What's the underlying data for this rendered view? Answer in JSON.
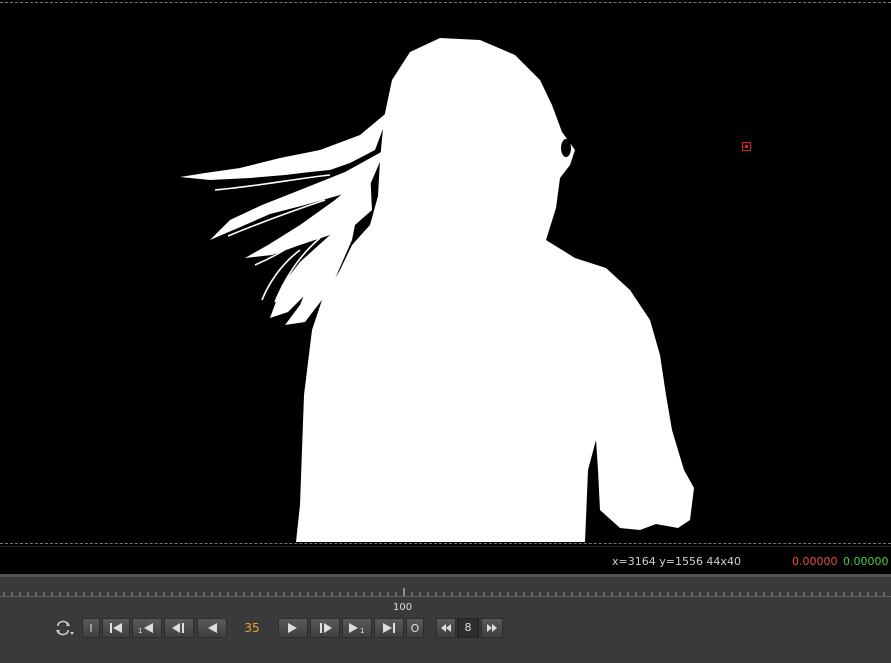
{
  "viewer": {
    "image": "white alpha matte of woman with long flowing hair on black background"
  },
  "info_bar": {
    "coords": "x=3164 y=1556 44x40",
    "red_value": "0.00000",
    "green_value": "0.00000"
  },
  "timeline": {
    "frame_label": "100",
    "current_frame": "35",
    "increment": "8",
    "in_label": "I",
    "out_label": "O"
  },
  "colors": {
    "accent_frame": "#f0a030",
    "red": "#e84a4a",
    "green": "#44d244",
    "sample_box": "#e02020"
  },
  "icons": [
    "loop-mode-icon",
    "go-to-start-icon",
    "step-back-increment-icon",
    "previous-keyframe-icon",
    "play-backward-icon",
    "play-forward-icon",
    "next-keyframe-icon",
    "step-forward-increment-icon",
    "go-to-end-icon",
    "rewind-icon",
    "fast-forward-icon"
  ]
}
